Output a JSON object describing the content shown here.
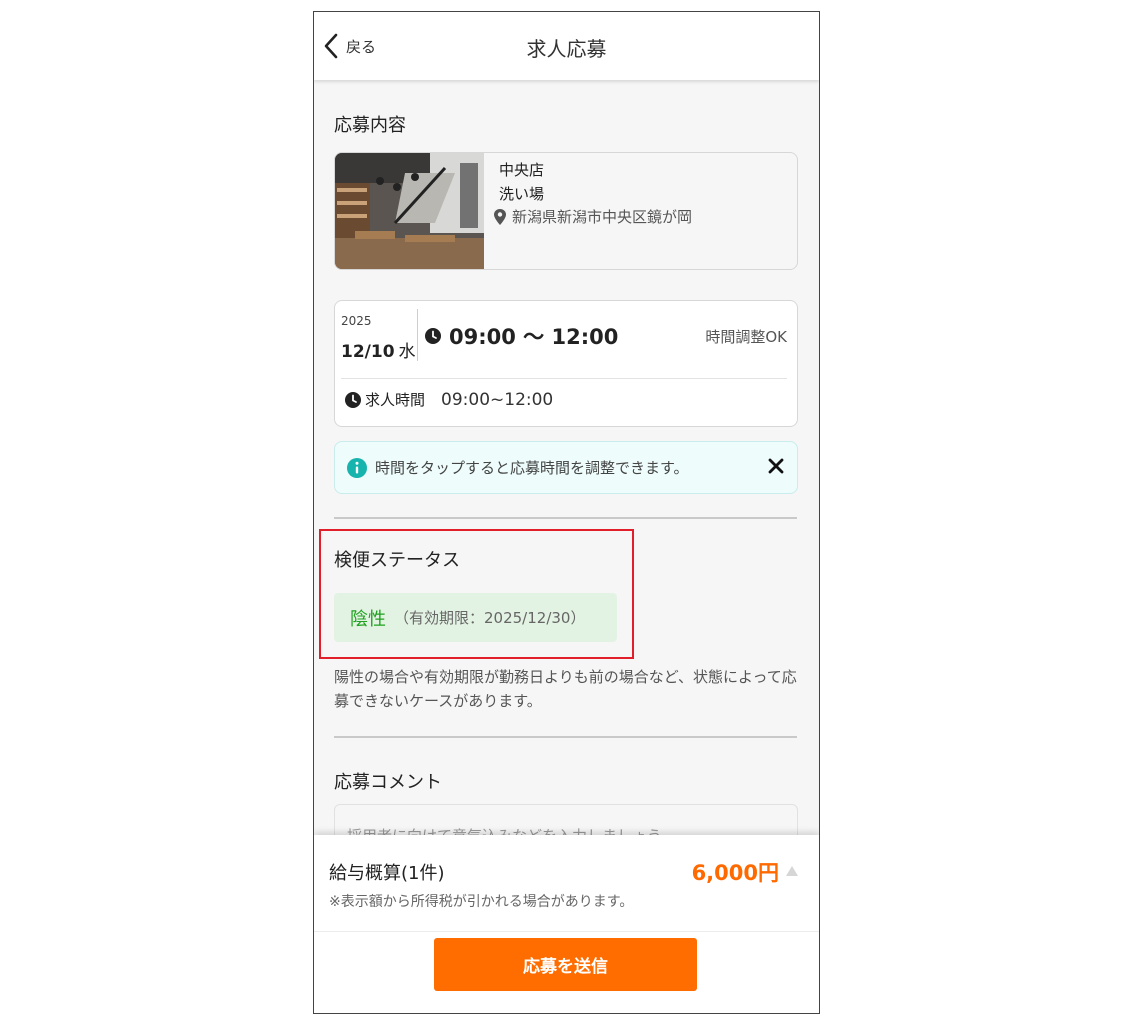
{
  "header": {
    "back_label": "戻る",
    "title": "求人応募"
  },
  "application": {
    "section_title": "応募内容",
    "shop": {
      "name": "中央店",
      "job": "洗い場",
      "address": "新潟県新潟市中央区鏡が岡"
    },
    "schedule": {
      "year": "2025",
      "date": "12/10",
      "weekday": "水",
      "time_slot": "09:00 〜 12:00",
      "adjust_note": "時間調整OK",
      "job_time_label": "求人時間",
      "job_time_value": "09:00~12:00"
    },
    "info_message": "時間をタップすると応募時間を調整できます。"
  },
  "stool_test": {
    "section_title": "検便ステータス",
    "result": "陰性",
    "expiry": "（有効期限：2025/12/30）",
    "note": "陽性の場合や有効期限が勤務日よりも前の場合など、状態によって応募できないケースがあります。"
  },
  "comment": {
    "section_title": "応募コメント",
    "placeholder": "採用者に向けて意気込みなどを入力しましょう"
  },
  "footer": {
    "pay_label": "給与概算(1件)",
    "pay_amount": "6,000円",
    "pay_note": "※表示額から所得税が引かれる場合があります。",
    "submit_label": "応募を送信"
  },
  "colors": {
    "accent": "#ff6c00",
    "negative_result": "#20a020",
    "highlight_border": "#e11e2a",
    "info_bg": "#eefcfc"
  },
  "icons": [
    "chevron-left-icon",
    "map-pin-icon",
    "clock-icon",
    "info-icon",
    "close-icon",
    "caret-up-icon"
  ]
}
